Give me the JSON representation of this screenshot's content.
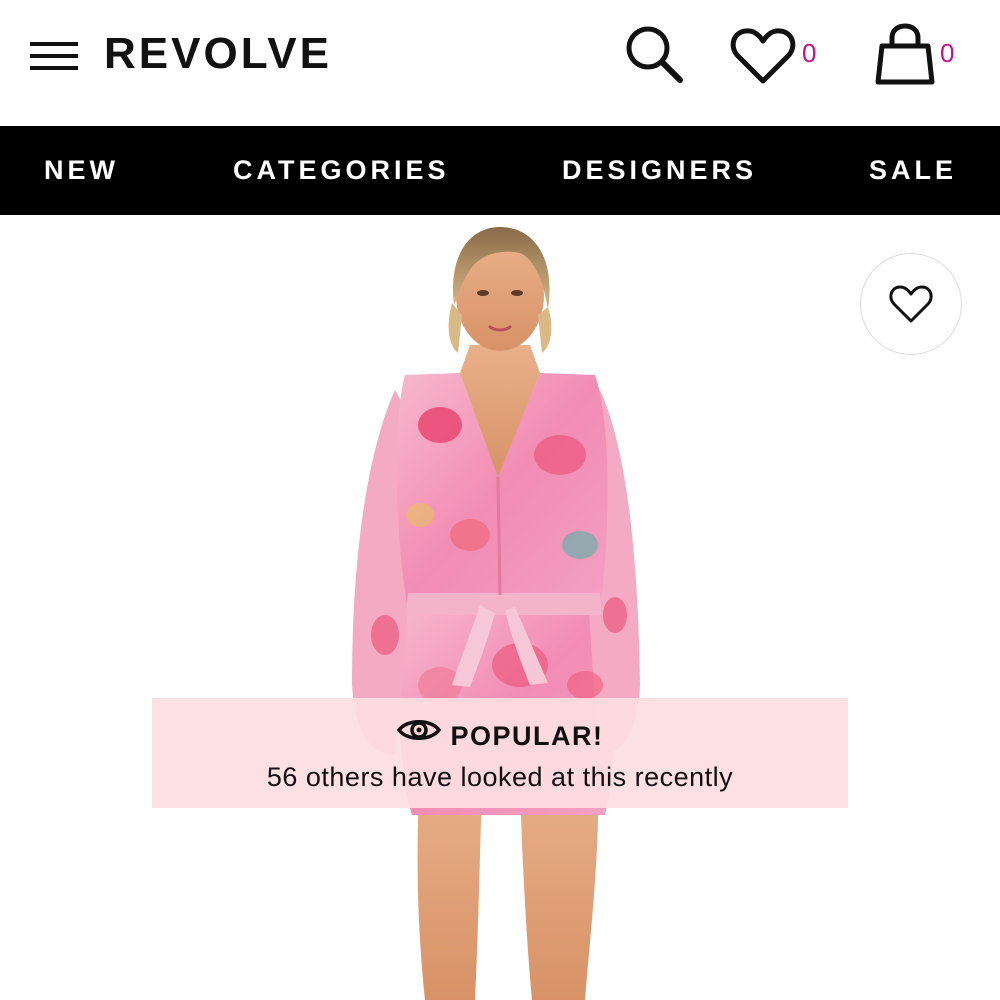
{
  "header": {
    "logo": "REVOLVE",
    "wishlist_count": "0",
    "bag_count": "0",
    "icons": {
      "menu": "hamburger-menu-icon",
      "search": "search-icon",
      "wishlist": "heart-icon",
      "bag": "shopping-bag-icon"
    }
  },
  "nav": {
    "items": [
      {
        "label": "NEW"
      },
      {
        "label": "CATEGORIES"
      },
      {
        "label": "DESIGNERS"
      },
      {
        "label": "SALE"
      }
    ]
  },
  "product": {
    "favorite_icon": "heart-outline-icon",
    "popular": {
      "title": "POPULAR!",
      "icon": "eye-icon",
      "message": "56 others have looked at this recently"
    }
  },
  "colors": {
    "accent_count": "#c2128d",
    "nav_bg": "#000000",
    "popular_bg": "#fdddE2"
  }
}
